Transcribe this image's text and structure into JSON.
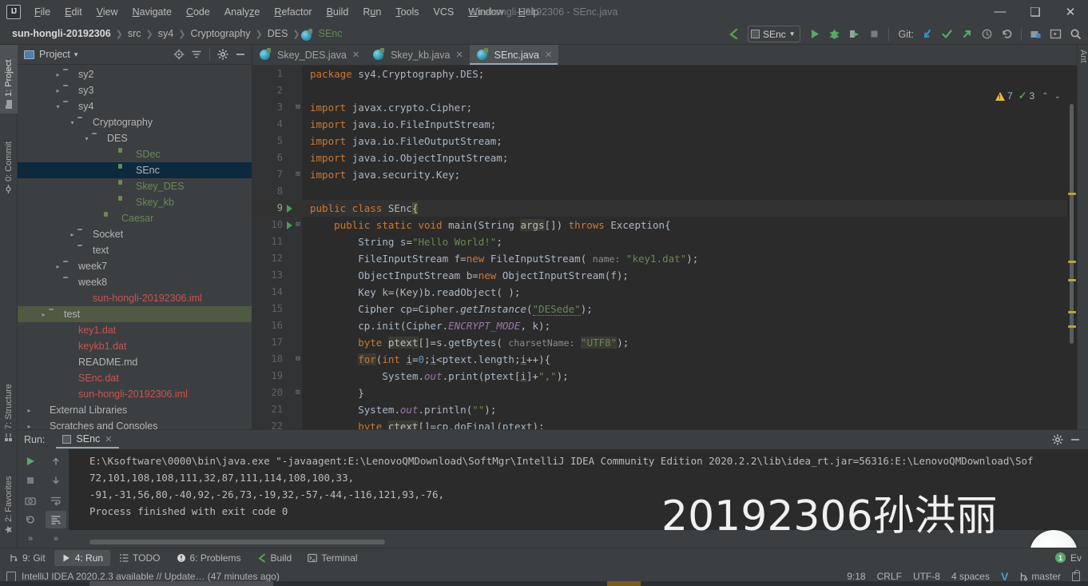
{
  "window": {
    "title": "sun-hongli-20192306 - SEnc.java",
    "minimize": "—",
    "maximize": "❐",
    "close": "✕"
  },
  "menu": [
    {
      "label": "File"
    },
    {
      "label": "Edit"
    },
    {
      "label": "View"
    },
    {
      "label": "Navigate"
    },
    {
      "label": "Code"
    },
    {
      "label": "Analyze"
    },
    {
      "label": "Refactor"
    },
    {
      "label": "Build"
    },
    {
      "label": "Run"
    },
    {
      "label": "Tools"
    },
    {
      "label": "VCS"
    },
    {
      "label": "Window"
    },
    {
      "label": "Help"
    }
  ],
  "breadcrumbs": [
    {
      "label": "sun-hongli-20192306",
      "type": "project"
    },
    {
      "label": "src",
      "type": "folder"
    },
    {
      "label": "sy4",
      "type": "folder"
    },
    {
      "label": "Cryptography",
      "type": "folder"
    },
    {
      "label": "DES",
      "type": "folder"
    },
    {
      "label": "SEnc",
      "type": "class"
    }
  ],
  "toolbar": {
    "run_config": "SEnc",
    "git_label": "Git:",
    "back_arrow": "↖",
    "run_button": "▶",
    "debug_button": "debug",
    "coverage_button": "coverage",
    "stop_button": "■",
    "update_project": "↙",
    "commit_button": "✓",
    "push_button": "↗",
    "history_button": "◷",
    "rollback_button": "↺",
    "search_button": "search"
  },
  "left_strip": [
    {
      "label": "1: Project",
      "selected": true
    },
    {
      "label": "0: Commit",
      "selected": false
    },
    {
      "label": "7: Structure",
      "selected": false
    },
    {
      "label": "2: Favorites",
      "selected": false
    }
  ],
  "project_panel": {
    "title": "Project",
    "dropdown_caret": "▾",
    "tools": [
      "locate-icon",
      "collapse-all-icon",
      "settings-icon",
      "hide-icon"
    ],
    "tree": [
      {
        "label": "sy2",
        "icon": "folder",
        "indent": 2,
        "arrow": "collapsed",
        "color": "norm"
      },
      {
        "label": "sy3",
        "icon": "folder",
        "indent": 2,
        "arrow": "collapsed",
        "color": "norm"
      },
      {
        "label": "sy4",
        "icon": "folder",
        "indent": 2,
        "arrow": "expanded",
        "color": "norm"
      },
      {
        "label": "Cryptography",
        "icon": "folder",
        "indent": 3,
        "arrow": "expanded",
        "color": "norm"
      },
      {
        "label": "DES",
        "icon": "folder",
        "indent": 4,
        "arrow": "expanded",
        "color": "norm"
      },
      {
        "label": "SDec",
        "icon": "class",
        "indent": 6,
        "arrow": "none",
        "color": "green"
      },
      {
        "label": "SEnc",
        "icon": "class",
        "indent": 6,
        "arrow": "none",
        "color": "norm",
        "selected": true
      },
      {
        "label": "Skey_DES",
        "icon": "class",
        "indent": 6,
        "arrow": "none",
        "color": "green"
      },
      {
        "label": "Skey_kb",
        "icon": "class",
        "indent": 6,
        "arrow": "none",
        "color": "green"
      },
      {
        "label": "Caesar",
        "icon": "class",
        "indent": 5,
        "arrow": "none",
        "color": "green"
      },
      {
        "label": "Socket",
        "icon": "folder",
        "indent": 3,
        "arrow": "collapsed",
        "color": "norm"
      },
      {
        "label": "text",
        "icon": "folder",
        "indent": 3,
        "arrow": "none",
        "color": "norm"
      },
      {
        "label": "week7",
        "icon": "folder",
        "indent": 2,
        "arrow": "collapsed",
        "color": "norm"
      },
      {
        "label": "week8",
        "icon": "folder",
        "indent": 2,
        "arrow": "none",
        "color": "norm"
      },
      {
        "label": "sun-hongli-20192306.iml",
        "icon": "iml",
        "indent": 3,
        "arrow": "none",
        "color": "redf"
      },
      {
        "label": "test",
        "icon": "folder-green",
        "indent": 1,
        "arrow": "collapsed",
        "color": "norm",
        "selected_green": true
      },
      {
        "label": "key1.dat",
        "icon": "dat",
        "indent": 2,
        "arrow": "none",
        "color": "redf"
      },
      {
        "label": "keykb1.dat",
        "icon": "dat",
        "indent": 2,
        "arrow": "none",
        "color": "redf"
      },
      {
        "label": "README.md",
        "icon": "md",
        "indent": 2,
        "arrow": "none",
        "color": "norm"
      },
      {
        "label": "SEnc.dat",
        "icon": "dat",
        "indent": 2,
        "arrow": "none",
        "color": "redf"
      },
      {
        "label": "sun-hongli-20192306.iml",
        "icon": "iml",
        "indent": 2,
        "arrow": "none",
        "color": "redf"
      },
      {
        "label": "External Libraries",
        "icon": "lib",
        "indent": 0,
        "arrow": "collapsed",
        "color": "norm"
      },
      {
        "label": "Scratches and Consoles",
        "icon": "scratch",
        "indent": 0,
        "arrow": "collapsed",
        "color": "norm"
      }
    ]
  },
  "editor": {
    "tabs": [
      {
        "label": "Skey_DES.java",
        "active": false,
        "close": "✕"
      },
      {
        "label": "Skey_kb.java",
        "active": false,
        "close": "✕"
      },
      {
        "label": "SEnc.java",
        "active": true,
        "close": "✕"
      }
    ],
    "inspection": {
      "warning_count": "7",
      "ok_count": "3",
      "up_caret": "⌃",
      "down_caret": "⌄"
    },
    "right_strip_label": "Ant",
    "lines": [
      {
        "n": "1",
        "runnable": false,
        "fold": "",
        "html": "<span class='kw'>package</span> <span class='id'>sy4.Cryptography.DES</span><span class='id'>;</span>"
      },
      {
        "n": "2",
        "runnable": false,
        "fold": "",
        "html": ""
      },
      {
        "n": "3",
        "runnable": false,
        "fold": "⊟",
        "html": "<span class='kw'>import</span> <span class='id'>javax.crypto.Cipher;</span>"
      },
      {
        "n": "4",
        "runnable": false,
        "fold": "",
        "html": "<span class='kw'>import</span> <span class='id'>java.io.FileInputStream;</span>"
      },
      {
        "n": "5",
        "runnable": false,
        "fold": "",
        "html": "<span class='kw'>import</span> <span class='id'>java.io.FileOutputStream;</span>"
      },
      {
        "n": "6",
        "runnable": false,
        "fold": "",
        "html": "<span class='kw'>import</span> <span class='id'>java.io.ObjectInputStream;</span>"
      },
      {
        "n": "7",
        "runnable": false,
        "fold": "⊡",
        "html": "<span class='kw'>import</span> <span class='id'>java.security.Key;</span>"
      },
      {
        "n": "8",
        "runnable": false,
        "fold": "",
        "html": ""
      },
      {
        "n": "9",
        "runnable": true,
        "fold": "",
        "html": "<span class='kw'>public class</span> <span class='id'>SEnc</span><span class='hl2'>{</span>"
      },
      {
        "n": "10",
        "runnable": true,
        "fold": "⊟",
        "html": "    <span class='kw'>public static void</span> <span class='id'>main</span>(<span class='id'>String</span> <span class='hl'>args</span>[]) <span class='kw'>throws</span> <span class='id'>Exception</span>{"
      },
      {
        "n": "11",
        "runnable": false,
        "fold": "",
        "html": "        <span class='id'>String</span> <span class='id'>s</span>=<span class='str'>\"Hello World!\"</span>;"
      },
      {
        "n": "12",
        "runnable": false,
        "fold": "",
        "html": "        <span class='id'>FileInputStream</span> <span class='id'>f</span>=<span class='kw'>new</span> <span class='id'>FileInputStream</span>( <span class='hint'>name:</span> <span class='str'>\"key1.dat\"</span>);"
      },
      {
        "n": "13",
        "runnable": false,
        "fold": "",
        "html": "        <span class='id'>ObjectInputStream</span> <span class='id'>b</span>=<span class='kw'>new</span> <span class='id'>ObjectInputStream</span>(<span class='id'>f</span>);"
      },
      {
        "n": "14",
        "runnable": false,
        "fold": "",
        "html": "        <span class='id'>Key</span> <span class='id'>k</span>=(<span class='id'>Key</span>)<span class='id'>b</span>.<span class='id'>readObject</span>( );"
      },
      {
        "n": "15",
        "runnable": false,
        "fold": "",
        "html": "        <span class='id'>Cipher</span> <span class='id'>cp</span>=<span class='id'>Cipher</span>.<span class='ital'>getInstance</span>(<span class='str sq-under'>\"DESede\"</span>);"
      },
      {
        "n": "16",
        "runnable": false,
        "fold": "",
        "html": "        <span class='id'>cp</span>.<span class='id'>init</span>(<span class='id'>Cipher</span>.<span class='field-ital'>ENCRYPT_MODE</span>, <span class='id'>k</span>);"
      },
      {
        "n": "17",
        "runnable": false,
        "fold": "",
        "html": "        <span class='kw'>byte</span> <span class='hl'>ptext</span>[]=<span class='id'>s</span>.<span class='id'>getBytes</span>( <span class='hint'>charsetName:</span> <span class='str hl'>\"UTF8\"</span>);"
      },
      {
        "n": "18",
        "runnable": false,
        "fold": "⊟",
        "html": "        <span class='kw hl'>for</span>(<span class='kw'>int</span> <span class='id underl'>i</span>=<span class='num'>0</span>;<span class='id underl'>i</span>&lt;<span class='id'>ptext</span>.<span class='id'>length</span>;<span class='id underl'>i</span>++){"
      },
      {
        "n": "19",
        "runnable": false,
        "fold": "",
        "html": "            <span class='id'>System</span>.<span class='field-ital'>out</span>.<span class='id'>print</span>(<span class='id'>ptext</span>[<span class='id underl'>i</span>]+<span class='str'>\",\"</span>);"
      },
      {
        "n": "20",
        "runnable": false,
        "fold": "⊡",
        "html": "        }"
      },
      {
        "n": "21",
        "runnable": false,
        "fold": "",
        "html": "        <span class='id'>System</span>.<span class='field-ital'>out</span>.<span class='id'>println</span>(<span class='str'>\"\"</span>);"
      },
      {
        "n": "22",
        "runnable": false,
        "fold": "",
        "html": "        <span class='kw'>byte</span> <span class='hl'>ctext</span>[]=<span class='id'>cp</span>.<span class='id'>doFinal</span>(<span class='id'>ptext</span>);"
      }
    ]
  },
  "run_panel": {
    "label": "Run:",
    "tab_label": "SEnc",
    "tab_close": "✕",
    "settings_icon": "gear-icon",
    "hide_icon": "hide-icon",
    "console_lines": [
      "E:\\Ksoftware\\0000\\bin\\java.exe \"-javaagent:E:\\LenovoQMDownload\\SoftMgr\\IntelliJ IDEA Community Edition 2020.2.2\\lib\\idea_rt.jar=56316:E:\\LenovoQMDownload\\Sof",
      "72,101,108,108,111,32,87,111,114,108,100,33,",
      "-91,-31,56,80,-40,92,-26,73,-19,32,-57,-44,-116,121,93,-76,",
      "Process finished with exit code 0"
    ]
  },
  "watermark": "20192306孙洪丽",
  "bottom_toolbar": [
    {
      "label": "9: Git",
      "icon": "git-icon",
      "selected": false
    },
    {
      "label": "4: Run",
      "icon": "run-icon",
      "selected": true
    },
    {
      "label": "TODO",
      "icon": "todo-icon",
      "selected": false
    },
    {
      "label": "6: Problems",
      "icon": "problems-icon",
      "selected": false
    },
    {
      "label": "Build",
      "icon": "build-icon",
      "selected": false
    },
    {
      "label": "Terminal",
      "icon": "terminal-icon",
      "selected": false
    }
  ],
  "event_log": {
    "count": "1",
    "label": "Ev"
  },
  "status_bar": {
    "message": "IntelliJ IDEA 2020.2.3 available // Update… (47 minutes ago)",
    "caret_position": "9:18",
    "line_separator": "CRLF",
    "encoding": "UTF-8",
    "indent": "4 spaces",
    "vcs_icon": "V",
    "branch": "master",
    "lock_icon": "lock-icon"
  }
}
